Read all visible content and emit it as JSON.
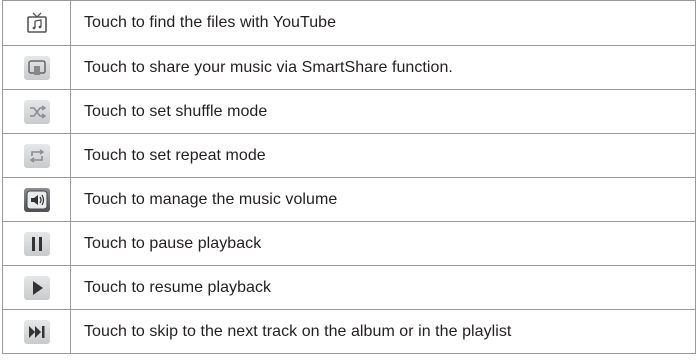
{
  "rows": [
    {
      "icon": "youtube-tv-icon",
      "text": "Touch to find the files with YouTube"
    },
    {
      "icon": "smartshare-icon",
      "text": "Touch to share your music via SmartShare function."
    },
    {
      "icon": "shuffle-icon",
      "text": "Touch to set shuffle mode"
    },
    {
      "icon": "repeat-icon",
      "text": "Touch to set repeat mode"
    },
    {
      "icon": "volume-icon",
      "text": "Touch to manage the music volume"
    },
    {
      "icon": "pause-icon",
      "text": "Touch to pause playback"
    },
    {
      "icon": "play-icon",
      "text": "Touch to resume playback"
    },
    {
      "icon": "next-track-icon",
      "text": "Touch to skip to the next track on the album or in the playlist"
    }
  ]
}
